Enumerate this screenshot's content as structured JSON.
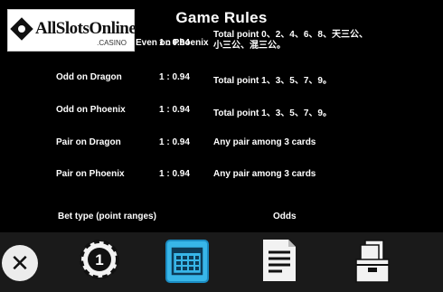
{
  "header": {
    "title": "Game Rules"
  },
  "logo": {
    "brand": "AllSlotsOnline",
    "sub": ".CASINO"
  },
  "rules": [
    {
      "type": "Even on Phoenix",
      "odds": "1 : 0.94",
      "desc_line1": "Total point 0、2、4、6、8、天三公、",
      "desc_line2": "小三公、混三公。"
    },
    {
      "type": "Odd on Dragon",
      "odds": "1 : 0.94",
      "desc_line1": "Total point 1、3、5、7、9。"
    },
    {
      "type": "Odd on Phoenix",
      "odds": "1 : 0.94",
      "desc_line1": "Total point 1、3、5、7、9。"
    },
    {
      "type": "Pair on Dragon",
      "odds": "1 : 0.94",
      "desc_line1": "Any pair among 3 cards"
    },
    {
      "type": "Pair on Phoenix",
      "odds": "1 : 0.94",
      "desc_line1": "Any pair among 3 cards"
    }
  ],
  "columns": {
    "bet_type": "Bet type (point ranges)",
    "odds": "Odds"
  },
  "toolbar": {
    "close_glyph": "✕",
    "chip_label": "1",
    "buttons": [
      "close-icon",
      "chip-icon",
      "calendar-grid-icon",
      "document-icon",
      "card-box-icon"
    ],
    "accent": "#38b6e8"
  }
}
